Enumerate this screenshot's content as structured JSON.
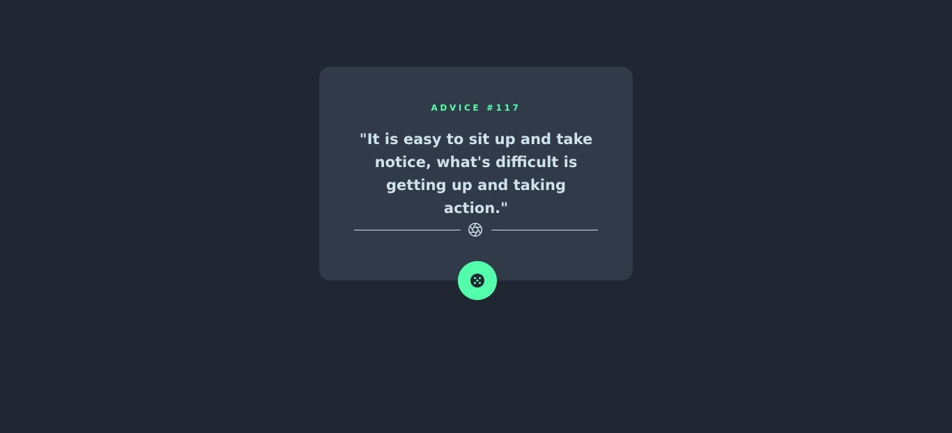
{
  "advice": {
    "label": "ADVICE #117",
    "quote": "\"It is easy to sit up and take notice, what's difficult is getting up and taking action.\""
  },
  "divider": {
    "icon": "aperture-icon"
  },
  "actions": {
    "dice_icon": "dice-icon"
  },
  "colors": {
    "background": "#202632",
    "card": "#313a48",
    "accent": "#53ffaa",
    "text": "#cee3e9"
  }
}
